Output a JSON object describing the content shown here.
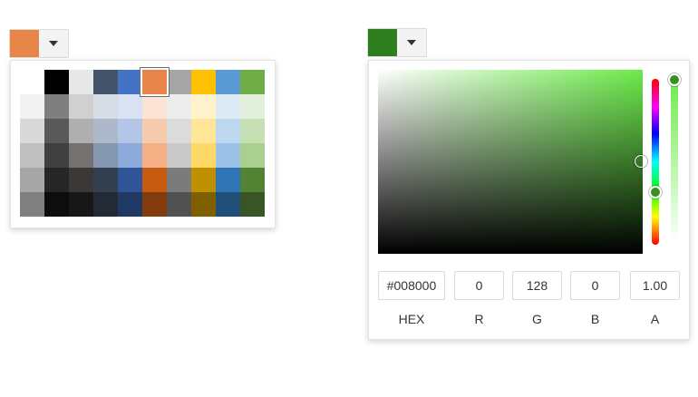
{
  "palette_picker": {
    "selected_color": "#e8854a",
    "colors": [
      [
        "#ffffff",
        "#000000",
        "#e7e7e7",
        "#44546a",
        "#4472c4",
        "#e8854a",
        "#a5a5a5",
        "#ffc000",
        "#5b9bd5",
        "#70ad47"
      ],
      [
        "#f2f2f2",
        "#7f7f7f",
        "#d0d0d0",
        "#d6dce4",
        "#d9e2f3",
        "#fbe4d5",
        "#ededed",
        "#fff2cc",
        "#ddebf7",
        "#e2efda"
      ],
      [
        "#d9d9d9",
        "#595959",
        "#afafaf",
        "#adb9ca",
        "#b4c6e7",
        "#f7cbad",
        "#dbdbdb",
        "#ffe699",
        "#bdd7ee",
        "#c6e0b4"
      ],
      [
        "#bfbfbf",
        "#404040",
        "#767171",
        "#8497b0",
        "#8eaadb",
        "#f4b084",
        "#c9c9c9",
        "#ffd966",
        "#9bc2e6",
        "#a9d08e"
      ],
      [
        "#a6a6a6",
        "#262626",
        "#3b3838",
        "#333f4f",
        "#2f5597",
        "#c55a11",
        "#7b7b7b",
        "#bf9000",
        "#2f75b5",
        "#548235"
      ],
      [
        "#808080",
        "#0d0d0d",
        "#171717",
        "#222a35",
        "#1f3864",
        "#843c0c",
        "#525252",
        "#7f6000",
        "#1f4e78",
        "#375623"
      ]
    ],
    "selected_index": [
      0,
      5
    ]
  },
  "gradient_picker": {
    "selected_color": "#2e7d1f",
    "hue_color": "#6ceb49",
    "hex": "#008000",
    "r": "0",
    "g": "128",
    "b": "0",
    "a": "1.00",
    "labels": {
      "hex": "HEX",
      "r": "R",
      "g": "G",
      "b": "B",
      "a": "A"
    }
  },
  "icons": {
    "dropdown": "chevron-down-icon"
  }
}
